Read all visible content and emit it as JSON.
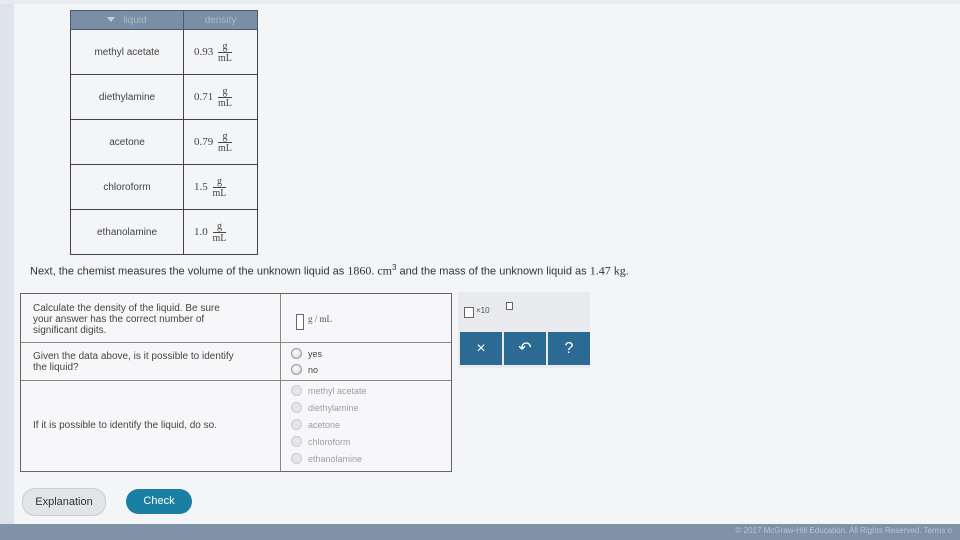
{
  "table": {
    "headers": [
      "liquid",
      "density"
    ],
    "rows": [
      {
        "name": "methyl acetate",
        "value": "0.93",
        "unit_num": "g",
        "unit_den": "mL"
      },
      {
        "name": "diethylamine",
        "value": "0.71",
        "unit_num": "g",
        "unit_den": "mL"
      },
      {
        "name": "acetone",
        "value": "0.79",
        "unit_num": "g",
        "unit_den": "mL"
      },
      {
        "name": "chloroform",
        "value": "1.5",
        "unit_num": "g",
        "unit_den": "mL"
      },
      {
        "name": "ethanolamine",
        "value": "1.0",
        "unit_num": "g",
        "unit_den": "mL"
      }
    ]
  },
  "statement": {
    "part1": "Next, the chemist measures the volume of the unknown liquid as ",
    "volume": "1860. cm",
    "volume_exp": "3",
    "part2": " and the mass of the unknown liquid as ",
    "mass": "1.47 kg",
    "end": "."
  },
  "questions": {
    "q1": {
      "line1": "Calculate the density of the liquid. Be sure",
      "line2": "your answer has the correct number of",
      "line3": "significant digits.",
      "unit": "g / mL"
    },
    "q2": {
      "line1": "Given the data above, is it possible to identify",
      "line2": "the liquid?",
      "options": [
        "yes",
        "no"
      ]
    },
    "q3": {
      "text": "If it is possible to identify the liquid, do so.",
      "options": [
        "methyl acetate",
        "diethylamine",
        "acetone",
        "chloroform",
        "ethanolamine"
      ]
    }
  },
  "tools": {
    "sci_label": "×10",
    "clear": "×",
    "undo": "↶",
    "help": "?"
  },
  "buttons": {
    "explanation": "Explanation",
    "check": "Check"
  },
  "footer": {
    "text": "© 2017 McGraw-Hill Education. All Rights Reserved.   Terms o"
  },
  "colors": {
    "accent": "#1a7fa3",
    "tool_button": "#2b6a93",
    "footer": "#7f92a8"
  }
}
